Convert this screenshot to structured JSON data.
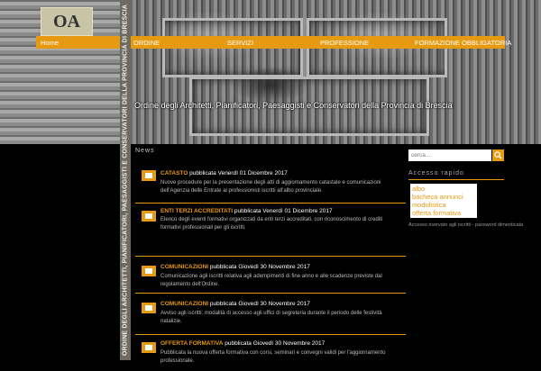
{
  "header": {
    "logo_text": "OA",
    "title": "Ordine degli Architetti, Pianificatori, Paesaggisti e Conservatori della Provincia di Brescia",
    "vertical_title": "ORDINE DEGLI ARCHITETTI, PIANIFICATORI, PAESAGGISTI E CONSERVATORI DELLA PROVINCIA DI BRESCIA"
  },
  "nav": {
    "home": "Home",
    "items": [
      "ORDINE",
      "SERVIZI",
      "PROFESSIONE",
      "FORMAZIONE OBBLIGATORIA"
    ]
  },
  "main": {
    "section_title": "News",
    "news": [
      {
        "category": "CATASTO",
        "date": "pubblicata Venerdì 01 Dicembre 2017",
        "body": "Nuove procedure per la presentazione degli atti di aggiornamento catastale e comunicazioni dell'Agenzia delle Entrate ai professionisti iscritti all'albo provinciale."
      },
      {
        "category": "ENTI TERZI ACCREDITATI",
        "date": "pubblicata Venerdì 01 Dicembre 2017",
        "body": "Elenco degli eventi formativi organizzati da enti terzi accreditati, con riconoscimento di crediti formativi professionali per gli iscritti."
      },
      {
        "category": "COMUNICAZIONI",
        "date": "pubblicata Giovedì 30 Novembre 2017",
        "body": "Comunicazione agli iscritti relativa agli adempimenti di fine anno e alle scadenze previste dal regolamento dell'Ordine."
      },
      {
        "category": "COMUNICAZIONI",
        "date": "pubblicata Giovedì 30 Novembre 2017",
        "body": "Avviso agli iscritti: modalità di accesso agli uffici di segreteria durante il periodo delle festività natalizie."
      },
      {
        "category": "OFFERTA FORMATIVA",
        "date": "pubblicata Giovedì 30 Novembre 2017",
        "body": "Pubblicata la nuova offerta formativa con corsi, seminari e convegni validi per l'aggiornamento professionale."
      }
    ]
  },
  "sidebar": {
    "search_placeholder": "cerca...",
    "heading": "Accesso rapido",
    "links": [
      "albo",
      "bacheca annunci",
      "modulistica",
      "offerta formativa"
    ],
    "note": "Accesso riservato agli iscritti - password dimenticata"
  },
  "colors": {
    "accent": "#e69a12",
    "background": "#000000"
  }
}
